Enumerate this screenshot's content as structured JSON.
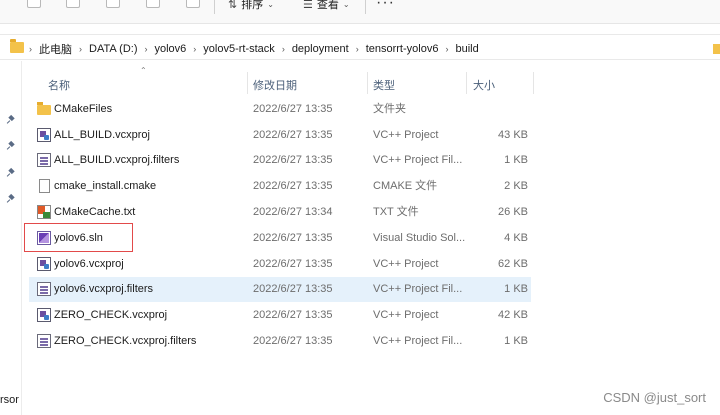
{
  "toolbar": {
    "sort_label": "排序",
    "view_label": "查看",
    "more_label": "···"
  },
  "breadcrumb": [
    "此电脑",
    "DATA (D:)",
    "yolov6",
    "yolov5-rt-stack",
    "deployment",
    "tensorrt-yolov6",
    "build"
  ],
  "columns": {
    "name": "名称",
    "date": "修改日期",
    "type": "类型",
    "size": "大小"
  },
  "files": [
    {
      "name": "CMakeFiles",
      "date": "2022/6/27 13:35",
      "type": "文件夹",
      "size": "",
      "icon": "folder-icon"
    },
    {
      "name": "ALL_BUILD.vcxproj",
      "date": "2022/6/27 13:35",
      "type": "VC++ Project",
      "size": "43 KB",
      "icon": "vcxproj-icon"
    },
    {
      "name": "ALL_BUILD.vcxproj.filters",
      "date": "2022/6/27 13:35",
      "type": "VC++ Project Fil...",
      "size": "1 KB",
      "icon": "filters-icon"
    },
    {
      "name": "cmake_install.cmake",
      "date": "2022/6/27 13:35",
      "type": "CMAKE 文件",
      "size": "2 KB",
      "icon": "file-icon"
    },
    {
      "name": "CMakeCache.txt",
      "date": "2022/6/27 13:34",
      "type": "TXT 文件",
      "size": "26 KB",
      "icon": "cmake-cache-icon"
    },
    {
      "name": "yolov6.sln",
      "date": "2022/6/27 13:35",
      "type": "Visual Studio Sol...",
      "size": "4 KB",
      "icon": "sln-icon"
    },
    {
      "name": "yolov6.vcxproj",
      "date": "2022/6/27 13:35",
      "type": "VC++ Project",
      "size": "62 KB",
      "icon": "vcxproj-icon"
    },
    {
      "name": "yolov6.vcxproj.filters",
      "date": "2022/6/27 13:35",
      "type": "VC++ Project Fil...",
      "size": "1 KB",
      "icon": "filters-icon"
    },
    {
      "name": "ZERO_CHECK.vcxproj",
      "date": "2022/6/27 13:35",
      "type": "VC++ Project",
      "size": "42 KB",
      "icon": "vcxproj-icon"
    },
    {
      "name": "ZERO_CHECK.vcxproj.filters",
      "date": "2022/6/27 13:35",
      "type": "VC++ Project Fil...",
      "size": "1 KB",
      "icon": "filters-icon"
    }
  ],
  "selected_row": 7,
  "highlighted_row": 5,
  "left_pane_label": "rsor",
  "watermark": "CSDN @just_sort",
  "colors": {
    "selection": "#e5f1fb",
    "highlight_border": "#e24a4a",
    "folder": "#f3c24a"
  }
}
